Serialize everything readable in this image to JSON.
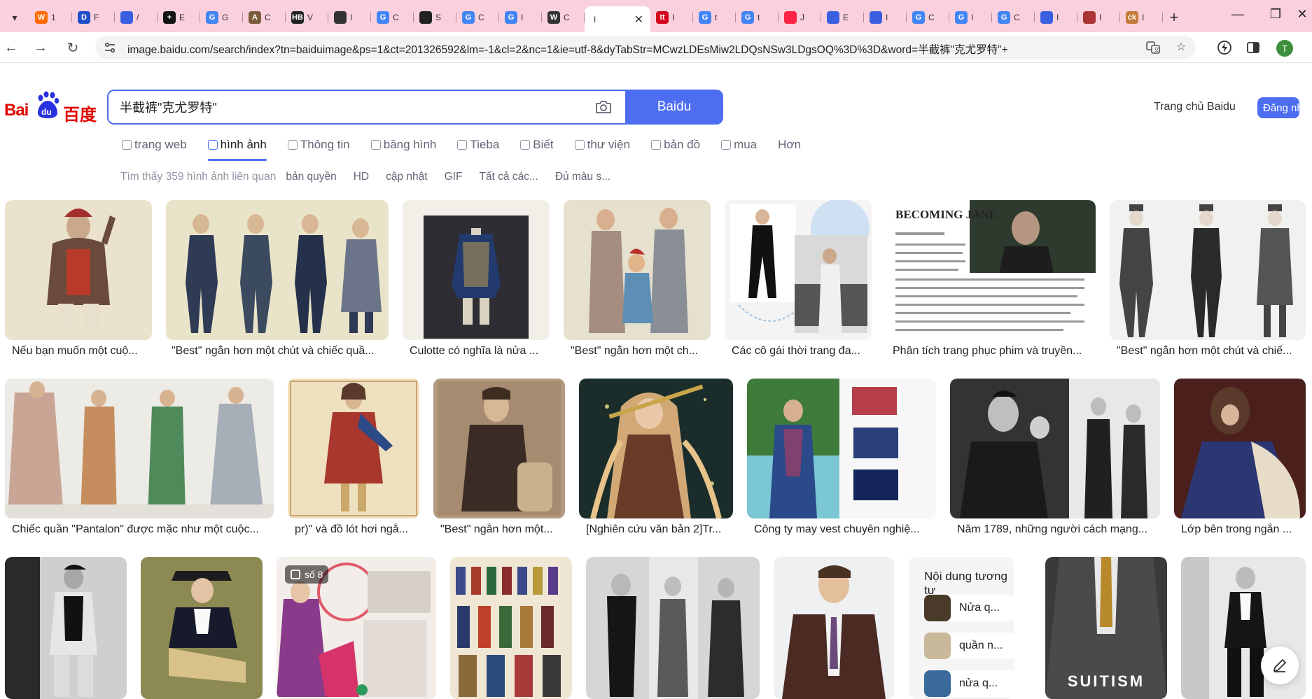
{
  "browser": {
    "tabs": [
      {
        "label": "1",
        "icon": "W",
        "color": "#ff6a00"
      },
      {
        "label": "F",
        "icon": "D",
        "color": "#1f4ec9"
      },
      {
        "label": "/",
        "icon": "paw",
        "color": "#3a5fe0"
      },
      {
        "label": "E",
        "icon": "+",
        "color": "#111111"
      },
      {
        "label": "G",
        "icon": "G",
        "color": "#4285f4"
      },
      {
        "label": "C",
        "icon": "A",
        "color": "#7a5b3a"
      },
      {
        "label": "V",
        "icon": "HB",
        "color": "#222222"
      },
      {
        "label": "I",
        "icon": "eye",
        "color": "#333333"
      },
      {
        "label": "C",
        "icon": "G",
        "color": "#4285f4"
      },
      {
        "label": "S",
        "icon": "bee",
        "color": "#222222"
      },
      {
        "label": "C",
        "icon": "G",
        "color": "#4285f4"
      },
      {
        "label": "I",
        "icon": "G",
        "color": "#4285f4"
      },
      {
        "label": "C",
        "icon": "W",
        "color": "#333333"
      },
      {
        "label": "I",
        "icon": "",
        "color": "#555555",
        "active": true
      },
      {
        "label": "I",
        "icon": "tt",
        "color": "#d4021a"
      },
      {
        "label": "t",
        "icon": "G",
        "color": "#4285f4"
      },
      {
        "label": "t",
        "icon": "G",
        "color": "#4285f4"
      },
      {
        "label": "J",
        "icon": "xhs",
        "color": "#ff2442"
      },
      {
        "label": "E",
        "icon": "paw",
        "color": "#3a5fe0"
      },
      {
        "label": "I",
        "icon": "paw",
        "color": "#3a5fe0"
      },
      {
        "label": "C",
        "icon": "G",
        "color": "#4285f4"
      },
      {
        "label": "I",
        "icon": "G",
        "color": "#4285f4"
      },
      {
        "label": "C",
        "icon": "G",
        "color": "#4285f4"
      },
      {
        "label": "I",
        "icon": "paw",
        "color": "#3a5fe0"
      },
      {
        "label": "I",
        "icon": "pic",
        "color": "#a33"
      },
      {
        "label": "I",
        "icon": "ck",
        "color": "#c47a3a"
      }
    ],
    "url": "image.baidu.com/search/index?tn=baiduimage&ps=1&ct=201326592&lm=-1&cl=2&nc=1&ie=utf-8&dyTabStr=MCwzLDEsMiw2LDQsNSw3LDgsOQ%3D%3D&word=半截裤\"克尤罗特\"+",
    "profile_initial": "T"
  },
  "baidu": {
    "logo_text_latin": "Bai",
    "logo_text_du": "du",
    "logo_text_cn": "百度",
    "search_value": "半截裤\"克尤罗特\"",
    "search_button": "Baidu",
    "home_link": "Trang chủ Baidu",
    "login_button": "Đăng nhập",
    "tabs": [
      "trang web",
      "hình ảnh",
      "Thông tin",
      "băng hình",
      "Tieba",
      "Biết",
      "thư viện",
      "bản đồ",
      "mua",
      "Hơn"
    ],
    "filters": {
      "found": "Tìm thấy 359 hình ảnh liên quan",
      "items": [
        "bản quyền",
        "HD",
        "cập nhật",
        "GIF",
        "Tất cả các...",
        "Đủ màu s..."
      ]
    }
  },
  "results": {
    "row1": [
      "Nếu bạn muốn một cuộ...",
      "\"Best\" ngắn hơn một chút và chiếc quầ...",
      "Culotte có nghĩa là nửa ...",
      "\"Best\" ngắn hơn một ch...",
      "Các cô gái thời trang đa...",
      "Phân tích trang phục phim và truyền...",
      "\"Best\" ngắn hơn một chút và chiế..."
    ],
    "row2": [
      "Chiếc quần \"Pantalon\" được mặc như một cuộc...",
      "pr)\" và đồ lót hơi ngắ...",
      "\"Best\" ngắn hơn một...",
      "[Nghiên cứu văn bản 2]Tr...",
      "Công ty may vest chuyên nghiệ...",
      "Năm 1789, những người cách mạng...",
      "Lớp bên trong ngắn ..."
    ],
    "badge_label": "số 8",
    "becoming_text": "BECOMING JANE",
    "suitism_text": "SUITISM",
    "similar": {
      "title": "Nội dung tương tự",
      "items": [
        "Nửa q...",
        "quần n...",
        "nửa q..."
      ]
    }
  }
}
